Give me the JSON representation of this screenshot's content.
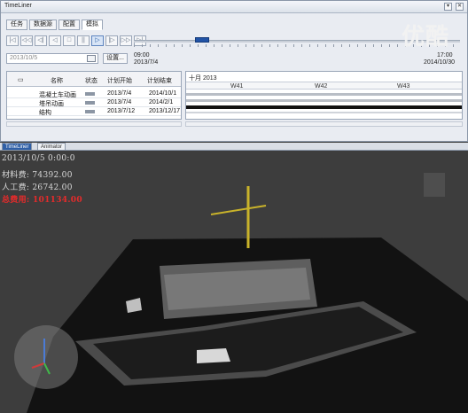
{
  "window": {
    "title": "TimeLiner",
    "watermark": "优酷"
  },
  "tabs": [
    "任务",
    "数据源",
    "配置",
    "模拟"
  ],
  "toolbar": {
    "buttons": [
      "|◁",
      "◁◁",
      "◁|",
      "◁",
      "□",
      "||",
      "▷",
      "|▷",
      "▷▷",
      "▷|"
    ]
  },
  "timeline": {
    "start_time": "09:00",
    "start_date": "2013/7/4",
    "end_time": "17:00",
    "end_date": "2014/10/30",
    "progress_fraction": 0.21
  },
  "date_field": {
    "value": "2013/10/5",
    "settings_label": "设置..."
  },
  "grid": {
    "headers": [
      "名称",
      "状态",
      "计划开始",
      "计划结束"
    ],
    "rows": [
      {
        "name": "混凝土车动画",
        "start": "2013/7/4",
        "end": "2014/10/1"
      },
      {
        "name": "塔吊动画",
        "start": "2013/7/4",
        "end": "2014/2/1"
      },
      {
        "name": "结构",
        "start": "2013/7/12",
        "end": "2013/12/17"
      }
    ]
  },
  "gantt": {
    "month": "十月 2013",
    "weeks": [
      "W41",
      "W42",
      "W43"
    ]
  },
  "bottom_tabs": [
    "TimeLiner",
    "Animator"
  ],
  "hud": {
    "datetime": "2013/10/5 0:00:0",
    "material_cost": "材料费: 74392.00",
    "labor_cost": "人工费: 26742.00",
    "total_cost": "总费用: 101134.00"
  },
  "colors": {
    "accent": "#2153a6",
    "total_cost": "#e52b2b"
  }
}
